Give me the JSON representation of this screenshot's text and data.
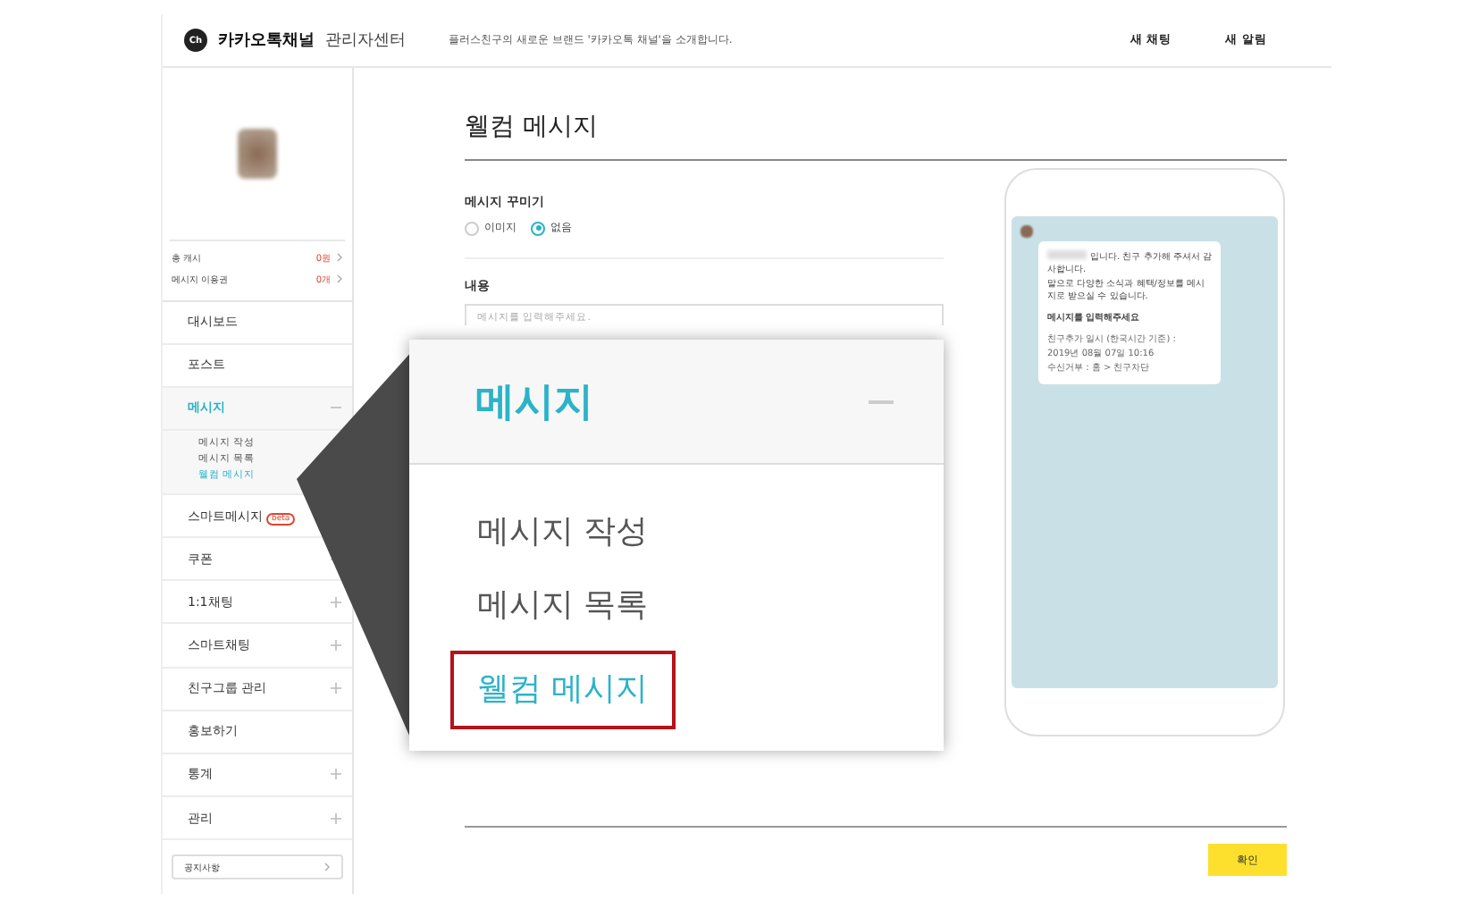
{
  "header": {
    "logo_mark": "Ch",
    "brand": "카카오톡채널",
    "brand_suffix": "관리자센터",
    "notice": "플러스친구의 새로운 브랜드 '카카오톡 채널'을 소개합니다.",
    "actions": [
      "새 채팅",
      "새 알림"
    ]
  },
  "sidebar": {
    "stats": [
      {
        "label": "총 캐시",
        "value": "0원"
      },
      {
        "label": "메시지 이용권",
        "value": "0개"
      }
    ],
    "menu": [
      {
        "label": "대시보드",
        "kind": "link",
        "selected": false
      },
      {
        "label": "포스트",
        "kind": "link",
        "selected": false
      },
      {
        "label": "메시지",
        "kind": "toggle",
        "expanded": true,
        "selected": true,
        "children": [
          {
            "label": "메시지 작성",
            "selected": false
          },
          {
            "label": "메시지 목록",
            "selected": false
          },
          {
            "label": "웰컴 메시지",
            "selected": true
          }
        ]
      },
      {
        "label": "스마트메시지",
        "kind": "link",
        "selected": false,
        "badge": "beta"
      },
      {
        "label": "쿠폰",
        "kind": "toggle",
        "expanded": false,
        "selected": false
      },
      {
        "label": "1:1채팅",
        "kind": "toggle",
        "expanded": false,
        "selected": false
      },
      {
        "label": "스마트채팅",
        "kind": "toggle",
        "expanded": false,
        "selected": false
      },
      {
        "label": "친구그룹 관리",
        "kind": "toggle",
        "expanded": false,
        "selected": false
      },
      {
        "label": "홍보하기",
        "kind": "link",
        "selected": false
      },
      {
        "label": "통계",
        "kind": "toggle",
        "expanded": false,
        "selected": false
      },
      {
        "label": "관리",
        "kind": "toggle",
        "expanded": false,
        "selected": false
      }
    ],
    "notice_link": "공지사항"
  },
  "main": {
    "title": "웰컴 메시지",
    "decorate": {
      "label": "메시지 꾸미기",
      "options": [
        {
          "label": "이미지",
          "selected": false
        },
        {
          "label": "없음",
          "selected": true
        }
      ]
    },
    "content": {
      "label": "내용",
      "placeholder": "메시지를 입력해주세요."
    },
    "confirm": "확인"
  },
  "preview": {
    "lines": [
      "입니다. 친구 추가해 주셔서 감사합니다.",
      "말으로 다양한 소식과 혜택/정보를 메시지로 받으실 수 있습니다."
    ],
    "emphasis": "메시지를 입력해주세요",
    "footer": [
      "친구추가 일시 (한국시간 기준) :",
      "2019년 08월 07일 10:16",
      "수신거부 : 홈 > 친구차단"
    ]
  },
  "callout": {
    "title": "메시지",
    "items": [
      {
        "label": "메시지 작성",
        "highlighted": false
      },
      {
        "label": "메시지 목록",
        "highlighted": false
      },
      {
        "label": "웰컴 메시지",
        "highlighted": true
      }
    ]
  }
}
